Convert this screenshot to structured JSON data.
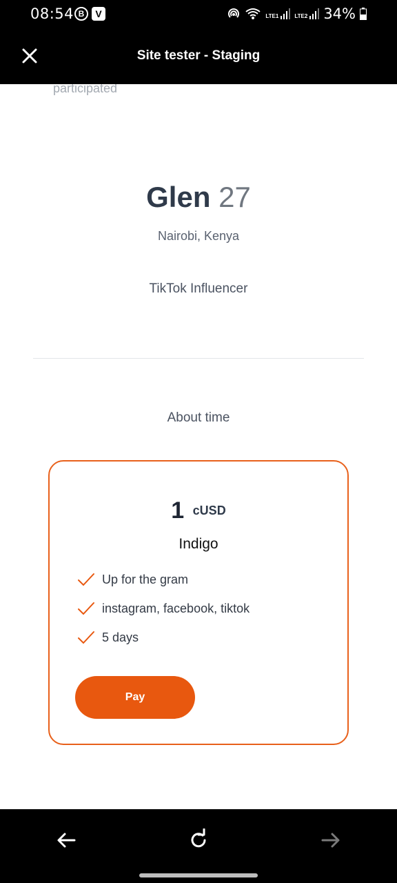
{
  "status_bar": {
    "time": "08:54",
    "badge_b": "B",
    "badge_v": "V",
    "sim1": "LTE1",
    "sim2": "LTE2",
    "battery": "34%"
  },
  "header": {
    "title": "Site tester - Staging",
    "close_icon": "close-icon"
  },
  "profile": {
    "participated_text": "participated",
    "name": "Glen",
    "age": "27",
    "location": "Nairobi, Kenya",
    "role": "TikTok Influencer"
  },
  "section_title": "About time",
  "offer_card": {
    "amount": "1",
    "unit": "cUSD",
    "plan_name": "Indigo",
    "features": [
      "Up for the gram",
      "instagram, facebook, tiktok",
      "5 days"
    ],
    "pay_label": "Pay"
  },
  "bottom_nav": {
    "back_icon": "arrow-left-icon",
    "reload_icon": "reload-icon",
    "forward_icon": "arrow-right-icon"
  },
  "colors": {
    "accent": "#e8580f",
    "card_border": "#e8601a",
    "text_dark": "#2f3a4a"
  }
}
